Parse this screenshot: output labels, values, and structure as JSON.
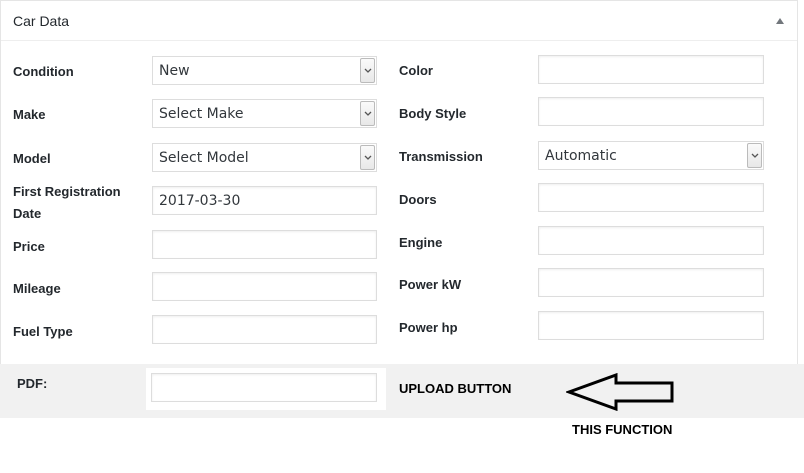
{
  "panel": {
    "title": "Car Data"
  },
  "left_fields": [
    {
      "label": "Condition",
      "type": "select",
      "value": "New"
    },
    {
      "label": "Make",
      "type": "select",
      "value": "Select Make"
    },
    {
      "label": "Model",
      "type": "select",
      "value": "Select Model"
    },
    {
      "label_line1": "First Registration",
      "label_line2": "Date",
      "type": "input",
      "value": "2017-03-30"
    },
    {
      "label": "Price",
      "type": "input",
      "value": ""
    },
    {
      "label": "Mileage",
      "type": "input",
      "value": ""
    },
    {
      "label": "Fuel Type",
      "type": "input",
      "value": ""
    }
  ],
  "right_fields": [
    {
      "label": "Color",
      "type": "input",
      "value": ""
    },
    {
      "label": "Body Style",
      "type": "input",
      "value": ""
    },
    {
      "label": "Transmission",
      "type": "select",
      "value": "Automatic"
    },
    {
      "label": "Doors",
      "type": "input",
      "value": ""
    },
    {
      "label": "Engine",
      "type": "input",
      "value": ""
    },
    {
      "label": "Power kW",
      "type": "input",
      "value": ""
    },
    {
      "label": "Power hp",
      "type": "input",
      "value": ""
    }
  ],
  "pdf": {
    "label": "PDF:",
    "value": ""
  },
  "annotations": {
    "upload": "UPLOAD BUTTON",
    "function": "THIS FUNCTION"
  },
  "colors": {
    "band": "#f1f1f1",
    "border": "#dddddd",
    "text": "#23282d"
  }
}
